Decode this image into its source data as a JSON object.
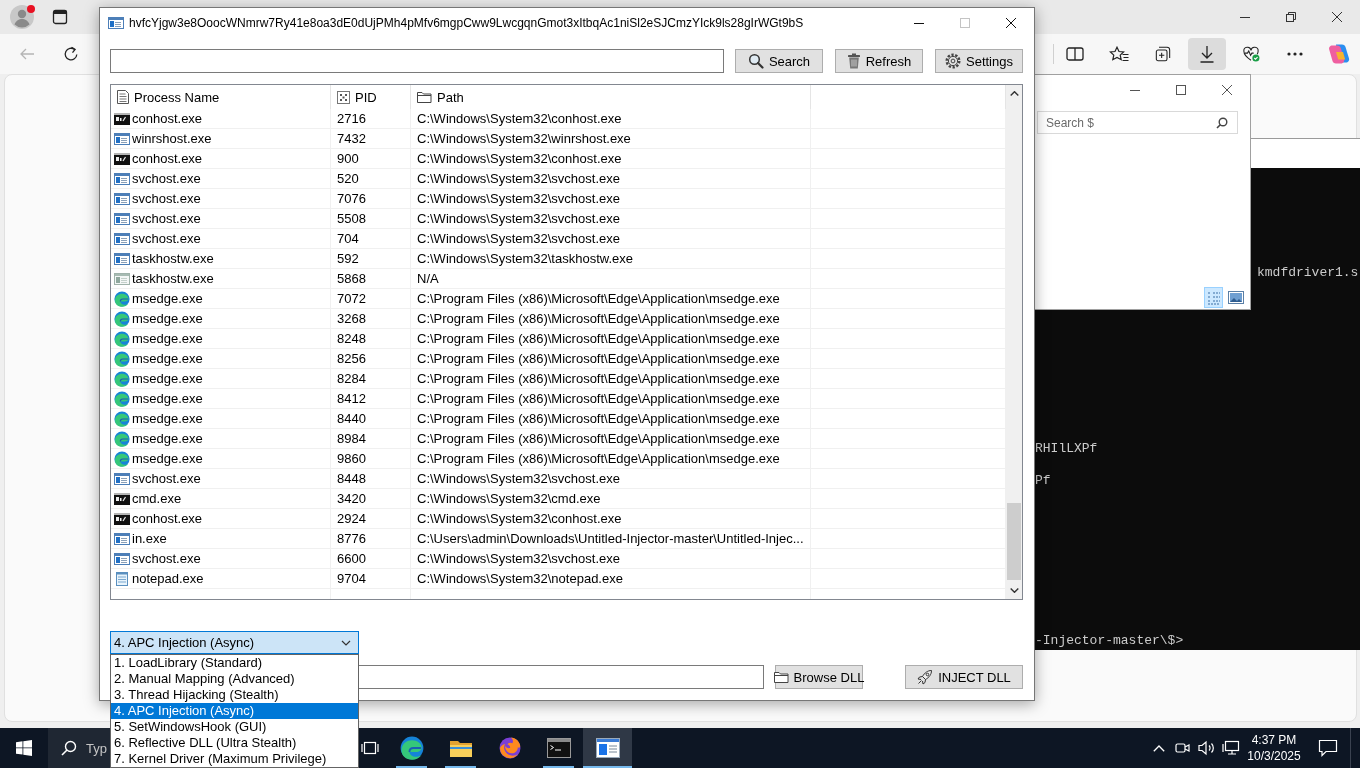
{
  "browser": {
    "profile": {
      "notification": true
    },
    "nav": [
      {
        "kind": "back",
        "disabled": true
      },
      {
        "kind": "refresh",
        "disabled": false
      }
    ],
    "toolbar": [
      {
        "kind": "split_screen",
        "selected": false
      },
      {
        "kind": "favorites",
        "selected": false
      },
      {
        "kind": "collections",
        "selected": false
      },
      {
        "kind": "downloads",
        "selected": true
      },
      {
        "kind": "browser_essentials",
        "selected": false
      },
      {
        "kind": "more",
        "selected": false
      },
      {
        "kind": "copilot",
        "selected": false
      }
    ]
  },
  "console": {
    "lines": [
      "kmdfdriver1.s",
      "RHIlLXPf",
      "Pf",
      "-Injector-master\\$>"
    ]
  },
  "file_window": {
    "search": {
      "placeholder": "Search $"
    },
    "view_buttons": [
      {
        "kind": "details",
        "selected": true
      },
      {
        "kind": "large_icons",
        "selected": false
      }
    ]
  },
  "window": {
    "title": "hvfcYjgw3e8OoocWNmrw7Ry41e8oa3dE0dUjPMh4pMfv6mgpCww9LwcgqnGmot3xItbqAc1niSl2eSJCmzYIck9ls28gIrWGt9bS",
    "controls": [
      {
        "kind": "minimize",
        "disabled": false
      },
      {
        "kind": "maximize",
        "disabled": true
      },
      {
        "kind": "close",
        "disabled": false
      }
    ],
    "toolbar_buttons": [
      {
        "kind": "search",
        "label": "Search"
      },
      {
        "kind": "refresh",
        "label": "Refresh"
      },
      {
        "kind": "settings",
        "label": "Settings"
      }
    ],
    "table": {
      "columns": [
        {
          "kind": "name",
          "label": "Process Name"
        },
        {
          "kind": "pid",
          "label": "PID"
        },
        {
          "kind": "path",
          "label": "Path"
        }
      ],
      "rows": [
        {
          "kind": "console",
          "name": "conhost.exe",
          "pid": "2716",
          "path": "C:\\Windows\\System32\\conhost.exe"
        },
        {
          "kind": "app",
          "name": "winrshost.exe",
          "pid": "7432",
          "path": "C:\\Windows\\System32\\winrshost.exe"
        },
        {
          "kind": "console",
          "name": "conhost.exe",
          "pid": "900",
          "path": "C:\\Windows\\System32\\conhost.exe"
        },
        {
          "kind": "app",
          "name": "svchost.exe",
          "pid": "520",
          "path": "C:\\Windows\\System32\\svchost.exe"
        },
        {
          "kind": "app",
          "name": "svchost.exe",
          "pid": "7076",
          "path": "C:\\Windows\\System32\\svchost.exe"
        },
        {
          "kind": "app",
          "name": "svchost.exe",
          "pid": "5508",
          "path": "C:\\Windows\\System32\\svchost.exe"
        },
        {
          "kind": "app",
          "name": "svchost.exe",
          "pid": "704",
          "path": "C:\\Windows\\System32\\svchost.exe"
        },
        {
          "kind": "app",
          "name": "taskhostw.exe",
          "pid": "592",
          "path": "C:\\Windows\\System32\\taskhostw.exe"
        },
        {
          "kind": "generic",
          "name": "taskhostw.exe",
          "pid": "5868",
          "path": "N/A"
        },
        {
          "kind": "edge",
          "name": "msedge.exe",
          "pid": "7072",
          "path": "C:\\Program Files (x86)\\Microsoft\\Edge\\Application\\msedge.exe"
        },
        {
          "kind": "edge",
          "name": "msedge.exe",
          "pid": "3268",
          "path": "C:\\Program Files (x86)\\Microsoft\\Edge\\Application\\msedge.exe"
        },
        {
          "kind": "edge",
          "name": "msedge.exe",
          "pid": "8248",
          "path": "C:\\Program Files (x86)\\Microsoft\\Edge\\Application\\msedge.exe"
        },
        {
          "kind": "edge",
          "name": "msedge.exe",
          "pid": "8256",
          "path": "C:\\Program Files (x86)\\Microsoft\\Edge\\Application\\msedge.exe"
        },
        {
          "kind": "edge",
          "name": "msedge.exe",
          "pid": "8284",
          "path": "C:\\Program Files (x86)\\Microsoft\\Edge\\Application\\msedge.exe"
        },
        {
          "kind": "edge",
          "name": "msedge.exe",
          "pid": "8412",
          "path": "C:\\Program Files (x86)\\Microsoft\\Edge\\Application\\msedge.exe"
        },
        {
          "kind": "edge",
          "name": "msedge.exe",
          "pid": "8440",
          "path": "C:\\Program Files (x86)\\Microsoft\\Edge\\Application\\msedge.exe"
        },
        {
          "kind": "edge",
          "name": "msedge.exe",
          "pid": "8984",
          "path": "C:\\Program Files (x86)\\Microsoft\\Edge\\Application\\msedge.exe"
        },
        {
          "kind": "edge",
          "name": "msedge.exe",
          "pid": "9860",
          "path": "C:\\Program Files (x86)\\Microsoft\\Edge\\Application\\msedge.exe"
        },
        {
          "kind": "app",
          "name": "svchost.exe",
          "pid": "8448",
          "path": "C:\\Windows\\System32\\svchost.exe"
        },
        {
          "kind": "console",
          "name": "cmd.exe",
          "pid": "3420",
          "path": "C:\\Windows\\System32\\cmd.exe"
        },
        {
          "kind": "console",
          "name": "conhost.exe",
          "pid": "2924",
          "path": "C:\\Windows\\System32\\conhost.exe"
        },
        {
          "kind": "app",
          "name": "in.exe",
          "pid": "8776",
          "path": "C:\\Users\\admin\\Downloads\\Untitled-Injector-master\\Untitled-Injec..."
        },
        {
          "kind": "app",
          "name": "svchost.exe",
          "pid": "6600",
          "path": "C:\\Windows\\System32\\svchost.exe"
        },
        {
          "kind": "notepad",
          "name": "notepad.exe",
          "pid": "9704",
          "path": "C:\\Windows\\System32\\notepad.exe"
        }
      ]
    },
    "method": {
      "value": "4. APC Injection (Async)",
      "expanded": true,
      "options": [
        {
          "label": "1. LoadLibrary (Standard)",
          "selected": false
        },
        {
          "label": "2. Manual Mapping (Advanced)",
          "selected": false
        },
        {
          "label": "3. Thread Hijacking (Stealth)",
          "selected": false
        },
        {
          "label": "4. APC Injection (Async)",
          "selected": true
        },
        {
          "label": "5. SetWindowsHook (GUI)",
          "selected": false
        },
        {
          "label": "6. Reflective DLL (Ultra Stealth)",
          "selected": false
        },
        {
          "label": "7. Kernel Driver (Maximum Privilege)",
          "selected": false
        }
      ]
    },
    "action_buttons": [
      {
        "kind": "browse",
        "label": "Browse DLL"
      },
      {
        "kind": "inject",
        "label": "INJECT DLL"
      }
    ]
  },
  "taskbar": {
    "search": {
      "placeholder": "Typ"
    },
    "apps": [
      {
        "kind": "task_view",
        "running": false,
        "selected": false
      },
      {
        "kind": "edge",
        "running": true,
        "selected": false
      },
      {
        "kind": "file_explorer",
        "running": true,
        "selected": false
      },
      {
        "kind": "firefox",
        "running": false,
        "selected": false
      },
      {
        "kind": "terminal",
        "running": true,
        "selected": false
      },
      {
        "kind": "app",
        "running": true,
        "selected": true
      }
    ],
    "tray": {
      "time": "4:37 PM",
      "date": "10/3/2025"
    }
  }
}
